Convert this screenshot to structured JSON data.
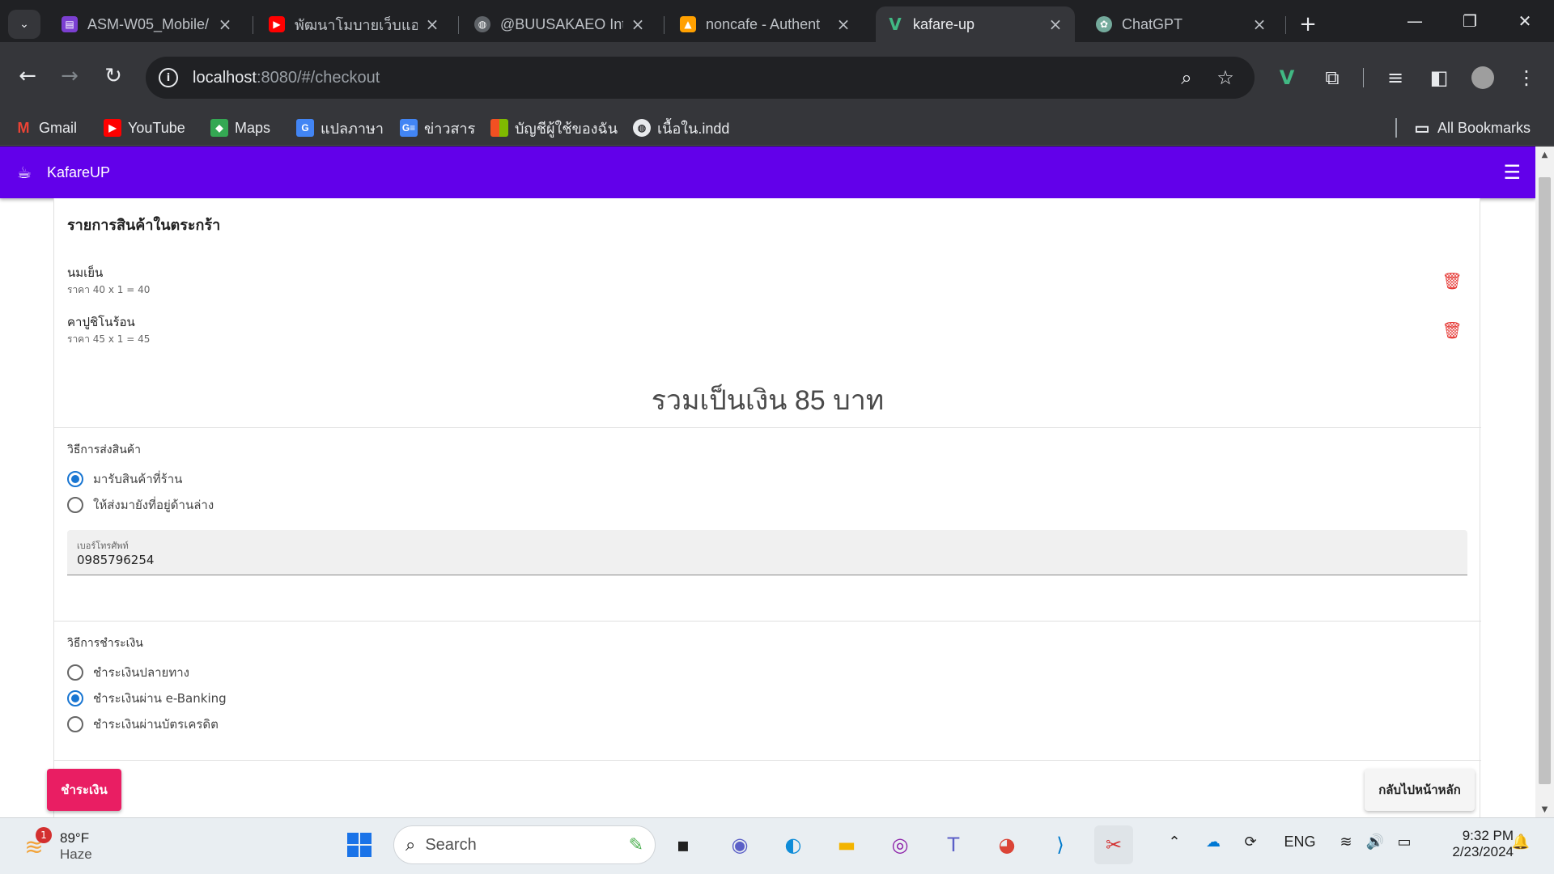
{
  "browser": {
    "tabs": [
      {
        "title": "ASM-W05_Mobile/",
        "favicon_color": "#7b3fd1",
        "active": false
      },
      {
        "title": "พัฒนาโมบายเว็บแอปพ",
        "favicon_color": "#ff0000",
        "active": false
      },
      {
        "title": "@BUUSAKAEO Inte",
        "favicon_color": "#5f6368",
        "active": false
      },
      {
        "title": "noncafe - Authent",
        "favicon_color": "#ffa000",
        "active": false
      },
      {
        "title": "kafare-up",
        "favicon_color": "#41b883",
        "active": true
      },
      {
        "title": "ChatGPT",
        "favicon_color": "#74aa9c",
        "active": false
      }
    ],
    "new_tab_label": "+",
    "url_host": "localhost",
    "url_rest": ":8080/#/checkout",
    "bookmarks": [
      {
        "label": "Gmail",
        "icon": "gmail-icon",
        "color": "#ea4335"
      },
      {
        "label": "YouTube",
        "icon": "youtube-icon",
        "color": "#ff0000"
      },
      {
        "label": "Maps",
        "icon": "maps-icon",
        "color": "#34a853"
      },
      {
        "label": "แปลภาษา",
        "icon": "translate-icon",
        "color": "#4285f4"
      },
      {
        "label": "ข่าวสาร",
        "icon": "news-icon",
        "color": "#4285f4"
      },
      {
        "label": "บัญชีผู้ใช้ของฉัน",
        "icon": "microsoft-icon",
        "color": "#f25022"
      },
      {
        "label": "เนื้อใน.indd",
        "icon": "globe-icon",
        "color": "#e8eaed"
      }
    ],
    "all_bookmarks_label": "All Bookmarks"
  },
  "app": {
    "brand": "KafareUP",
    "cart_heading": "รายการสินค้าในตระกร้า",
    "items": [
      {
        "name": "นมเย็น",
        "detail": "ราคา 40 x 1 = 40"
      },
      {
        "name": "คาปูชิโนร้อน",
        "detail": "ราคา 45 x 1 = 45"
      }
    ],
    "total": "รวมเป็นเงิน 85 บาท",
    "shipping": {
      "label": "วิธีการส่งสินค้า",
      "options": [
        {
          "label": "มารับสินค้าที่ร้าน",
          "selected": true
        },
        {
          "label": "ให้ส่งมายังที่อยู่ด้านล่าง",
          "selected": false
        }
      ],
      "phone_label": "เบอร์โทรศัพท์",
      "phone_value": "0985796254"
    },
    "payment": {
      "label": "วิธีการชำระเงิน",
      "options": [
        {
          "label": "ชำระเงินปลายทาง",
          "selected": false
        },
        {
          "label": "ชำระเงินผ่าน e-Banking",
          "selected": true
        },
        {
          "label": "ชำระเงินผ่านบัตรเครดิต",
          "selected": false
        }
      ]
    },
    "pay_button": "ชำระเงิน",
    "back_button": "กลับไปหน้าหลัก"
  },
  "taskbar": {
    "weather_temp": "89°F",
    "weather_desc": "Haze",
    "weather_badge": "1",
    "search_label": "Search",
    "lang": "ENG",
    "time": "9:32 PM",
    "date": "2/23/2024"
  }
}
